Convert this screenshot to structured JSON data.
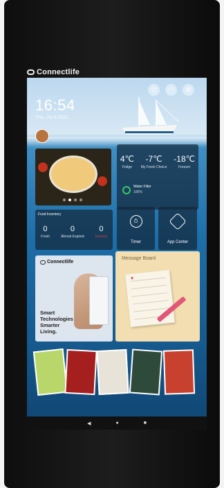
{
  "brand": {
    "name": "Connectlife"
  },
  "status": {
    "time": "16:54",
    "date": "Thu, Jul 8 2021"
  },
  "weather_tile": {
    "temps": [
      {
        "value": "4℃",
        "label": "Fridge"
      },
      {
        "value": "-7℃",
        "label": "My Fresh Choice"
      },
      {
        "value": "-18℃",
        "label": "Freezer"
      }
    ],
    "water_filter": {
      "title": "Water Filter",
      "value": "100%"
    }
  },
  "inventory": {
    "title": "Food Inventory",
    "columns": [
      {
        "count": "0",
        "label": "Fresh"
      },
      {
        "count": "0",
        "label": "Almost Expired"
      },
      {
        "count": "0",
        "label": "Expired"
      }
    ]
  },
  "timer": {
    "label": "Timer"
  },
  "app_center": {
    "label": "App Center"
  },
  "connectlife_tile": {
    "logo": "Connectlife",
    "slogan_lines": [
      "Smart",
      "Technologies",
      "Smarter",
      "Living."
    ]
  },
  "message_board": {
    "title": "Message Board"
  },
  "nav": {
    "back": "◀",
    "home": "●",
    "recents": "■"
  },
  "colors": {
    "accent_green": "#39c864",
    "expired_red": "#e04040"
  }
}
